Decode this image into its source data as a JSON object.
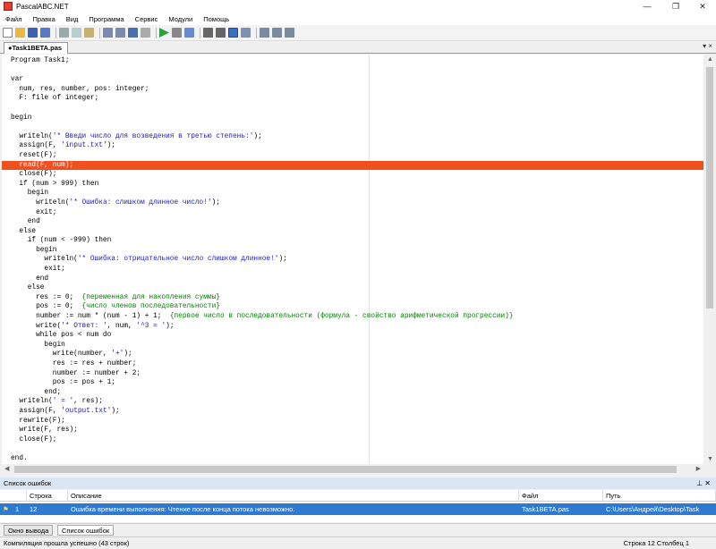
{
  "window": {
    "title": "PascalABC.NET"
  },
  "menu": [
    "Файл",
    "Правка",
    "Вид",
    "Программа",
    "Сервис",
    "Модули",
    "Помощь"
  ],
  "toolbar": {
    "icons": [
      "new-file",
      "open",
      "save",
      "save-all",
      "cut",
      "copy",
      "paste",
      "undo",
      "redo",
      "find",
      "run",
      "stop",
      "compile",
      "debug",
      "step-into",
      "step-over",
      "output",
      "breakpoint",
      "form",
      "window"
    ]
  },
  "tab": {
    "label": "●Task1BETA.pas",
    "close_glyph": "▾ ×"
  },
  "editor": {
    "highlight_line_index": 11,
    "highlight_color": "#f05020",
    "lines": [
      "Program Task1;",
      "",
      "var",
      "  num, res, number, pos: integer;",
      "  F: file of integer;",
      "",
      "begin",
      "",
      "  writeln('* Введи число для возведения в третью степень:');",
      "  assign(F, 'input.txt');",
      "  reset(F);",
      "  read(F, num);",
      "  close(F);",
      "  if (num > 999) then",
      "    begin",
      "      writeln('* Ошибка: слишком длинное число!');",
      "      exit;",
      "    end",
      "  else",
      "    if (num < -999) then",
      "      begin",
      "        writeln('* Ошибка: отрицательное число слишком длинное!');",
      "        exit;",
      "      end",
      "    else",
      "      res := 0;  {переменная для накопления суммы}",
      "      pos := 0;  {число членов последовательности}",
      "      number := num * (num - 1) + 1;  {первое число в последовательности (формула - свойство арифметической прогрессии)}",
      "      write('* Ответ: ', num, '^3 = ');",
      "      while pos < num do",
      "        begin",
      "          write(number, '+');",
      "          res := res + number;",
      "          number := number + 2;",
      "          pos := pos + 1;",
      "        end;",
      "  writeln(' = ', res);",
      "  assign(F, 'output.txt');",
      "  rewrite(F);",
      "  write(F, res);",
      "  close(F);",
      "",
      "end."
    ]
  },
  "errors": {
    "title": "Список ошибок",
    "columns": [
      "",
      "Строка",
      "Описание",
      "Файл",
      "Путь"
    ],
    "rows": [
      {
        "index": "1",
        "line": "12",
        "description": "Ошибка времени выполнения: Чтение после конца потока невозможно.",
        "file": "Task1BETA.pas",
        "path": "C:\\Users\\Андрей\\Desktop\\Task"
      }
    ]
  },
  "bottom_tabs": [
    "Окно вывода",
    "Список ошибок"
  ],
  "status": {
    "message": "Компиляция прошла успешно (43 строк)",
    "position": "Строка  12  Столбец  1"
  },
  "colors": {
    "selection": "#2e7ad1",
    "panel_header": "#dbe6f4"
  }
}
